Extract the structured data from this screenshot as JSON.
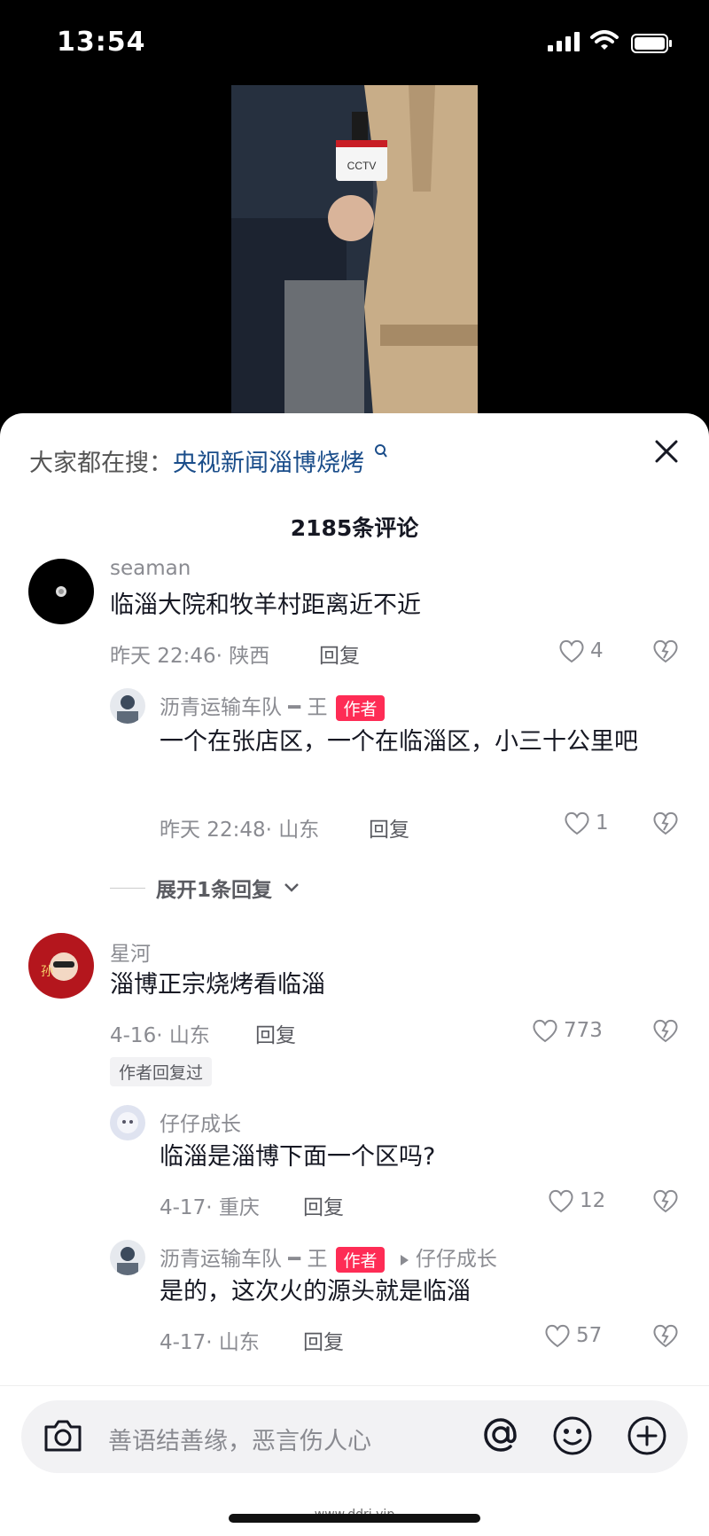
{
  "status_bar": {
    "time": "13:54"
  },
  "search_suggestion": {
    "prefix": "大家都在搜：",
    "query": "央视新闻淄博烧烤"
  },
  "comment_count": "2185条评论",
  "comments": [
    {
      "user": "seaman",
      "text": "临淄大院和牧羊村距离近不近",
      "meta": "昨天 22:46· 陕西",
      "reply_label": "回复",
      "likes": "4",
      "replies": [
        {
          "user": "沥青运输车队 ━ 王",
          "badge": "作者",
          "text": "一个在张店区，一个在临淄区，小三十公里吧",
          "meta": "昨天 22:48· 山东",
          "reply_label": "回复",
          "likes": "1"
        }
      ],
      "expand_label": "展开1条回复"
    },
    {
      "user": "星河",
      "text": "淄博正宗烧烤看临淄",
      "meta": "4-16· 山东",
      "reply_label": "回复",
      "likes": "773",
      "tag": "作者回复过",
      "replies": [
        {
          "user": "仔仔成长",
          "text": "临淄是淄博下面一个区吗?",
          "meta": "4-17· 重庆",
          "reply_label": "回复",
          "likes": "12"
        },
        {
          "user": "沥青运输车队 ━ 王",
          "badge": "作者",
          "reply_to": "仔仔成长",
          "text": "是的，这次火的源头就是临淄",
          "meta": "4-17· 山东",
          "reply_label": "回复",
          "likes": "57"
        }
      ]
    }
  ],
  "input": {
    "placeholder": "善语结善缘，恶言伤人心"
  },
  "watermark": "www.ddri.vip",
  "colors": {
    "accent": "#fe2c55",
    "link": "#1a4d8a"
  },
  "icons": [
    "camera-icon",
    "at-icon",
    "emoji-icon",
    "plus-icon",
    "close-icon",
    "heart-icon",
    "dislike-icon",
    "search-icon",
    "chevron-down-icon"
  ]
}
